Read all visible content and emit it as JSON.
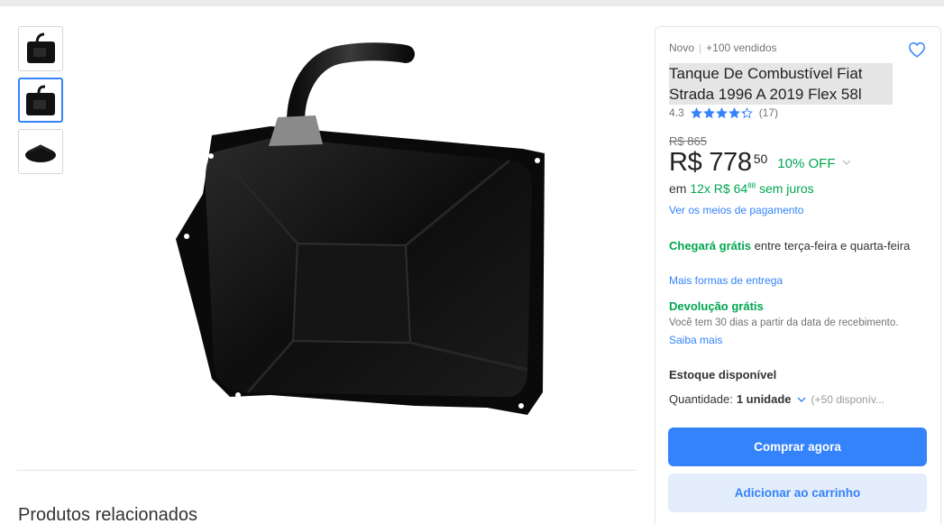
{
  "product": {
    "condition": "Novo",
    "sold": "+100 vendidos",
    "title": "Tanque De Combustível Fiat Strada 1996 A 2019 Flex 58l",
    "rating_value": "4.3",
    "rating_count": "(17)",
    "rating": 4.3,
    "old_price": "R$ 865",
    "price_main": "R$ 778",
    "price_cents": "50",
    "discount": "10% OFF",
    "installments_prefix": "em ",
    "installments_value": "12x R$ 64",
    "installments_cents": "88",
    "installments_suffix": " sem juros",
    "payment_link": "Ver os meios de pagamento"
  },
  "shipping": {
    "title": "Chegará grátis",
    "text": " entre terça-feira e quarta-feira",
    "link": "Mais formas de entrega"
  },
  "returns": {
    "title": "Devolução grátis",
    "text": "Você tem 30 dias a partir da data de recebimento.",
    "link": "Saiba mais"
  },
  "stock": {
    "label": "Estoque disponível",
    "quantity_label": "Quantidade:",
    "quantity_value": "1 unidade",
    "available": "(+50 disponív..."
  },
  "buttons": {
    "buy": "Comprar agora",
    "cart": "Adicionar ao carrinho"
  },
  "related": {
    "title": "Produtos relacionados"
  },
  "colors": {
    "accent": "#3483fa",
    "green": "#00a650",
    "star": "#3483fa"
  },
  "icons": {
    "favorite": "heart-outline-icon",
    "star": "star-icon",
    "chevron": "chevron-down-icon"
  }
}
